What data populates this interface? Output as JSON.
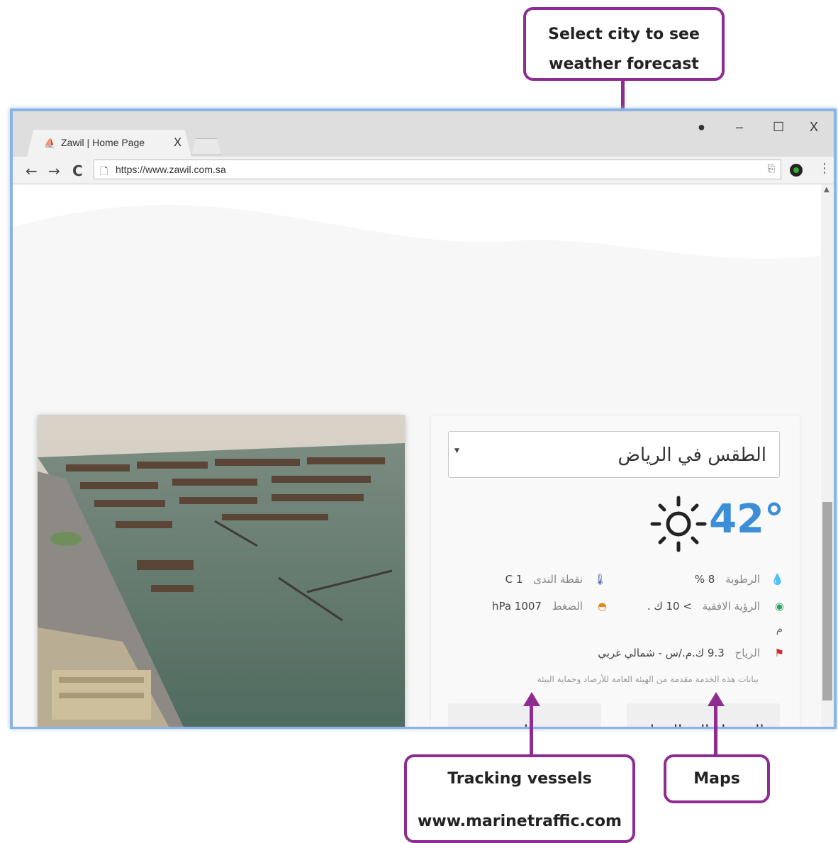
{
  "callouts": {
    "forecast": {
      "line1": "Select city to see",
      "line2": "weather forecast"
    },
    "vessels": {
      "line1": "Tracking vessels",
      "line2": "www.marinetraffic.com"
    },
    "maps": {
      "line1": "Maps"
    }
  },
  "browser": {
    "tab_title": "Zawil | Home Page",
    "tab_close": "X",
    "url": "https://www.zawil.com.sa",
    "window_buttons": {
      "profile": "⏷",
      "minimize": "–",
      "maximize": "☐",
      "close": "X"
    },
    "nav": {
      "back": "←",
      "forward": "→",
      "reload": "C"
    }
  },
  "weather": {
    "city_select": "الطقس في الرياض",
    "temperature": "42°",
    "humidity_label": "الرطوبة",
    "humidity_value": "8 %",
    "dewpoint_label": "نقطة الندى",
    "dewpoint_value": "1 C",
    "visibility_label": "الرؤية الافقية",
    "visibility_value": "> 10 ك .",
    "visibility_unit": "م",
    "pressure_label": "الضغط",
    "pressure_value": "1007 hPa",
    "wind_label": "الرياح",
    "wind_value": "9.3 ك.م./س - شمالي غربي",
    "source_note": "بيانات هذه الخدمة مقدمة من الهيئة العامة للأرصاد وحماية البيئة"
  },
  "actions": {
    "port_access": "الوصول إلى الميناء",
    "track_ships": "تتبع السفن"
  },
  "colors": {
    "callout_border": "#8e2c91",
    "window_border": "#8db3e2",
    "temperature": "#3d8ed8"
  }
}
